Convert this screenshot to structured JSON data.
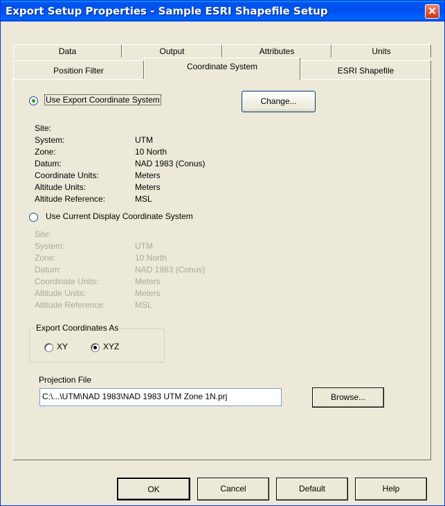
{
  "window": {
    "title": "Export Setup Properties - Sample ESRI Shapefile Setup",
    "close_glyph": "✕"
  },
  "tabs": {
    "back_row": [
      {
        "label": "Data"
      },
      {
        "label": "Output"
      },
      {
        "label": "Attributes"
      },
      {
        "label": "Units"
      }
    ],
    "front_row": [
      {
        "label": "Position Filter"
      },
      {
        "label": "Coordinate System",
        "active": true
      },
      {
        "label": "ESRI Shapefile"
      }
    ]
  },
  "export_cs": {
    "radio_label": "Use Export Coordinate System",
    "radio_accel": "E",
    "selected": true,
    "change_button": "Change...",
    "change_accel": "C",
    "rows": [
      {
        "label": "Site:",
        "value": ""
      },
      {
        "label": "System:",
        "value": "UTM"
      },
      {
        "label": "Zone:",
        "value": "10 North"
      },
      {
        "label": "Datum:",
        "value": "NAD 1983 (Conus)"
      },
      {
        "label": "Coordinate Units:",
        "value": "Meters"
      },
      {
        "label": "Altitude Units:",
        "value": "Meters"
      },
      {
        "label": "Altitude Reference:",
        "value": "MSL"
      }
    ]
  },
  "display_cs": {
    "radio_label": "Use Current Display Coordinate System",
    "radio_accel": "i",
    "selected": false,
    "rows": [
      {
        "label": "Site:",
        "value": ""
      },
      {
        "label": "System:",
        "value": "UTM"
      },
      {
        "label": "Zone:",
        "value": "10 North"
      },
      {
        "label": "Datum:",
        "value": "NAD 1983 (Conus)"
      },
      {
        "label": "Coordinate Units:",
        "value": "Meters"
      },
      {
        "label": "Altitude Units:",
        "value": "Meters"
      },
      {
        "label": "Altitude Reference:",
        "value": "MSL"
      }
    ]
  },
  "export_coords": {
    "group_title": "Export Coordinates As",
    "options": [
      {
        "label": "XY",
        "selected": false
      },
      {
        "label": "XYZ",
        "selected": true
      }
    ]
  },
  "projection": {
    "label": "Projection File",
    "value": "C:\\...\\UTM\\NAD 1983\\NAD 1983 UTM Zone 1N.prj",
    "browse_button": "Browse..."
  },
  "footer": {
    "ok": "OK",
    "cancel": "Cancel",
    "default": "Default",
    "help": "Help"
  },
  "colors": {
    "title_bar": "#0053ee",
    "dialog_bg": "#ece9d8",
    "disabled_text": "#aca899",
    "close_button": "#e2522d"
  }
}
